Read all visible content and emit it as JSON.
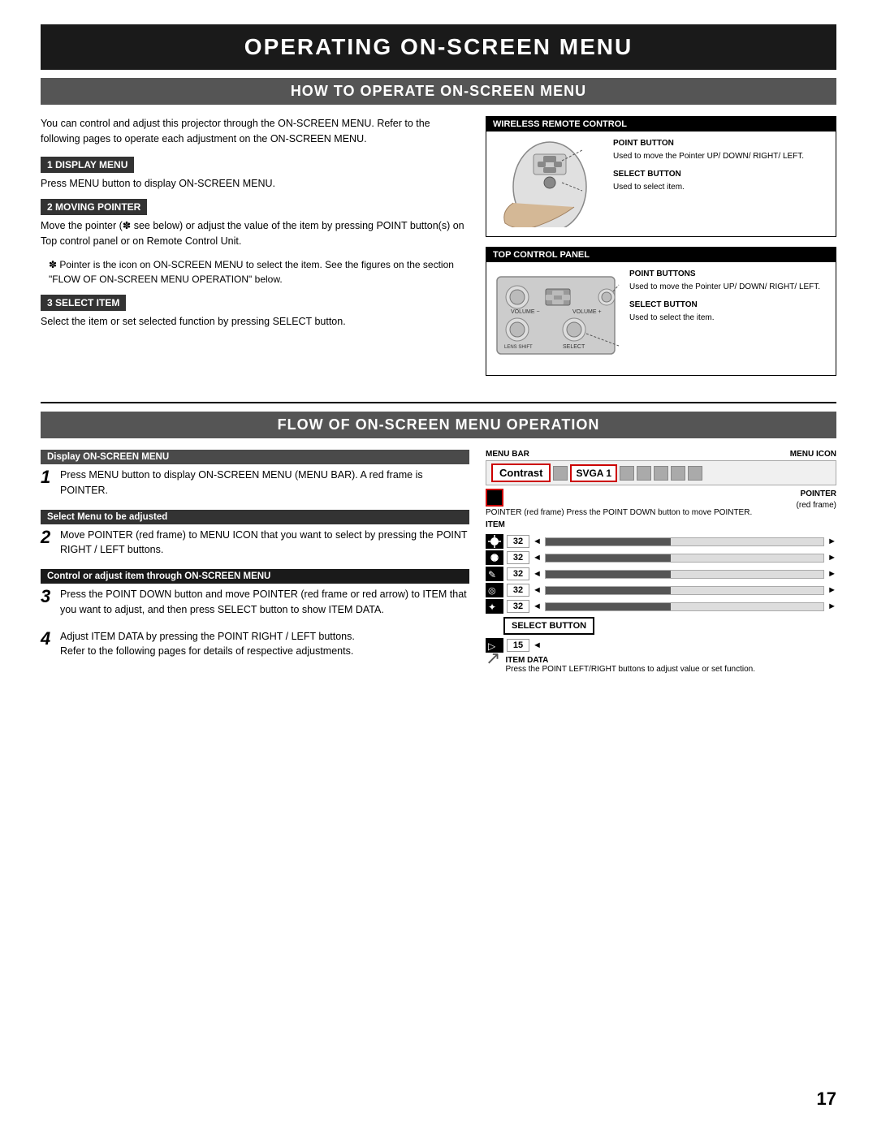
{
  "page": {
    "main_title": "OPERATING ON-SCREEN MENU",
    "section1_title": "HOW TO OPERATE ON-SCREEN MENU",
    "section2_title": "FLOW OF ON-SCREEN MENU OPERATION",
    "page_number": "17"
  },
  "intro": {
    "text": "You can control and adjust this projector through the ON-SCREEN MENU. Refer to the following pages to operate each adjustment on the ON-SCREEN MENU."
  },
  "steps": {
    "step1_label": "1  DISPLAY MENU",
    "step1_text": "Press MENU button to display ON-SCREEN MENU.",
    "step2_label": "2  MOVING POINTER",
    "step2_text": "Move the pointer (✽ see below) or adjust the value of the item by pressing POINT button(s) on Top control panel or on Remote Control Unit.",
    "asterisk_note": "✽  Pointer is the icon on ON-SCREEN MENU to select the item. See the figures on the section \"FLOW OF ON-SCREEN MENU OPERATION\" below.",
    "step3_label": "3  SELECT ITEM",
    "step3_text": "Select the item or set selected function by pressing SELECT button."
  },
  "wireless_remote": {
    "header": "WIRELESS REMOTE CONTROL",
    "point_button_label": "POINT BUTTON",
    "point_button_desc": "Used to move the Pointer UP/ DOWN/ RIGHT/ LEFT.",
    "select_button_label": "SELECT BUTTON",
    "select_button_desc": "Used to select item."
  },
  "top_control": {
    "header": "TOP CONTROL PANEL",
    "point_buttons_label": "POINT BUTTONS",
    "point_buttons_desc": "Used to move the Pointer UP/ DOWN/ RIGHT/ LEFT.",
    "select_button_label": "SELECT BUTTON",
    "select_button_desc": "Used to select the item."
  },
  "flow": {
    "step1_header": "Display ON-SCREEN MENU",
    "step1_number": "1",
    "step1_text": "Press MENU button to display ON-SCREEN MENU (MENU BAR). A red frame is POINTER.",
    "step2_header": "Select Menu to be adjusted",
    "step2_number": "2",
    "step2_text": "Move POINTER (red frame) to MENU ICON that you want to select by pressing the POINT RIGHT / LEFT buttons.",
    "step3_header": "Control or adjust item through ON-SCREEN MENU",
    "step3_number": "3",
    "step3_text": "Press the POINT DOWN button and move POINTER (red frame or red arrow) to ITEM that you want to adjust, and then press SELECT button to show ITEM DATA.",
    "step4_number": "4",
    "step4_text": "Adjust ITEM DATA by pressing the POINT RIGHT / LEFT buttons.\nRefer to the following pages for details of respective adjustments."
  },
  "diagram": {
    "menu_bar_label": "MENU BAR",
    "menu_icon_label": "MENU ICON",
    "pointer_label": "POINTER",
    "pointer_desc": "(red frame)",
    "pointer_note": "POINTER (red frame)\nPress the POINT DOWN button to move POINTER.",
    "item_label": "ITEM",
    "select_button_box": "SELECT\nBUTTON",
    "item_data_label": "ITEM DATA",
    "item_data_desc": "Press the POINT LEFT/RIGHT buttons to adjust value or set function.",
    "contrast_label": "Contrast",
    "svga_label": "SVGA 1",
    "items": [
      {
        "icon_color": "#000",
        "value": "32",
        "has_bar": true,
        "bar_fill": 45
      },
      {
        "icon_color": "#000",
        "value": "32",
        "has_bar": true,
        "bar_fill": 45
      },
      {
        "icon_color": "#000",
        "value": "32",
        "has_bar": true,
        "bar_fill": 45
      },
      {
        "icon_color": "#000",
        "value": "32",
        "has_bar": true,
        "bar_fill": 45
      },
      {
        "icon_color": "#000",
        "value": "32",
        "has_bar": true,
        "bar_fill": 45
      },
      {
        "icon_color": "#000",
        "value": "15",
        "has_bar": false,
        "bar_fill": 0
      }
    ]
  }
}
